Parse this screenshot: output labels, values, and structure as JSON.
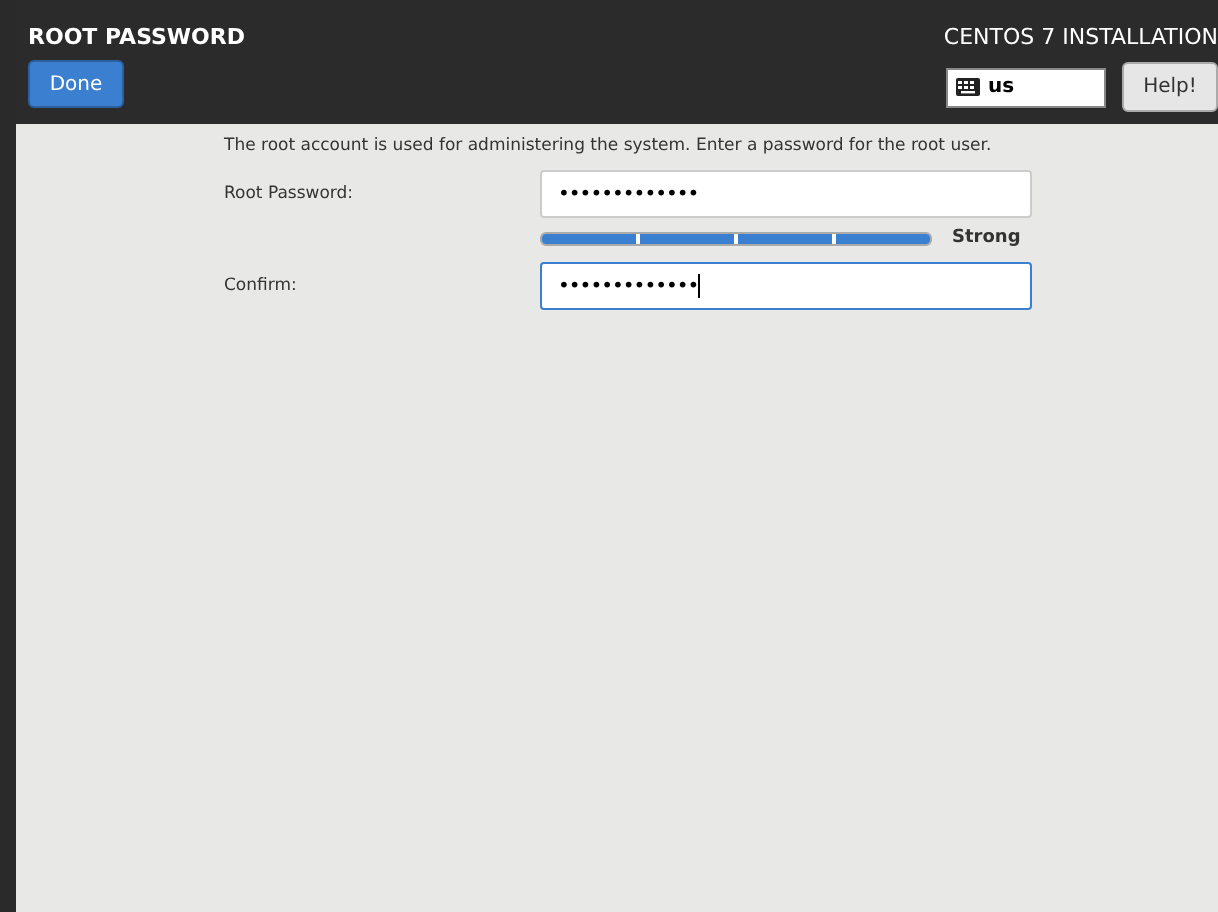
{
  "header": {
    "title": "ROOT PASSWORD",
    "done_button": "Done",
    "product": "CENTOS 7 INSTALLATION",
    "keyboard_layout": "us",
    "help_button": "Help!"
  },
  "intro": "The root account is used for administering the system.  Enter a password for the root user.",
  "password": {
    "label": "Root Password:",
    "value": "•••••••••••••",
    "focused": false
  },
  "strength": {
    "level": 1,
    "label": "Strong"
  },
  "confirm": {
    "label": "Confirm:",
    "value": "•••••••••••••",
    "focused": true
  }
}
